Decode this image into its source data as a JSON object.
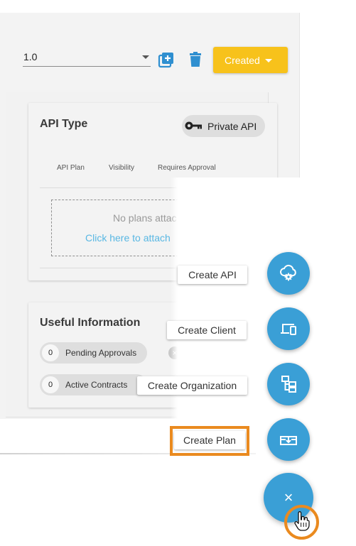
{
  "header": {
    "version_value": "1.0",
    "status_label": "Created"
  },
  "api_card": {
    "title": "API Type",
    "badge_label": "Private API",
    "columns": [
      "API Plan",
      "Visibility",
      "Requires Approval"
    ],
    "empty_text": "No plans attac",
    "attach_link": "Click here to attach "
  },
  "info_card": {
    "title": "Useful Information",
    "pending": {
      "count": "0",
      "label": "Pending Approvals"
    },
    "contracts": {
      "count": "0",
      "label": "Active Contracts"
    }
  },
  "speed_dial": {
    "actions": [
      {
        "label": "Create API",
        "icon": "cloud-gear-icon"
      },
      {
        "label": "Create Client",
        "icon": "devices-icon"
      },
      {
        "label": "Create Organization",
        "icon": "org-tree-icon"
      },
      {
        "label": "Create Plan",
        "icon": "plan-tray-icon"
      }
    ],
    "close_symbol": "×",
    "highlighted_action": "Create Plan"
  },
  "colors": {
    "accent_blue": "#3a9fd6",
    "status_yellow": "#f7c21b",
    "highlight_orange": "#ea8a1f",
    "link_blue": "#58b7e3"
  }
}
